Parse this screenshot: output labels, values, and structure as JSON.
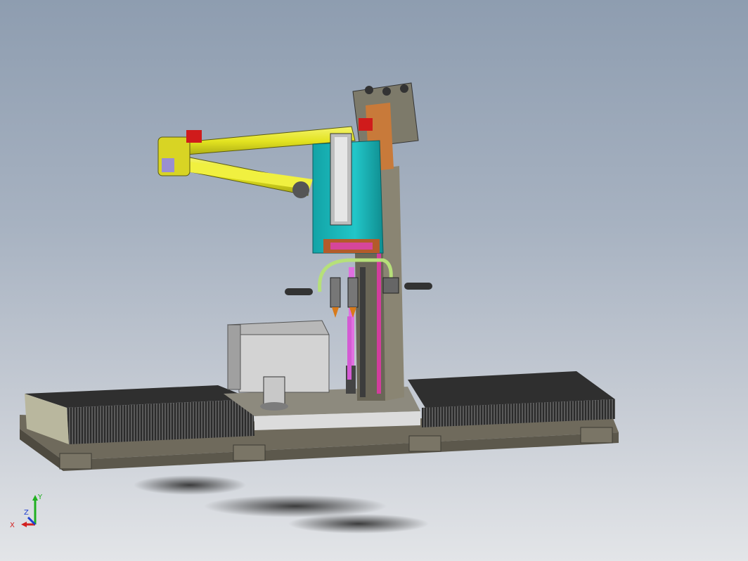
{
  "viewport": {
    "background_top": "#8e9db0",
    "background_bottom": "#e3e5e8"
  },
  "triad": {
    "x_label": "X",
    "y_label": "Y",
    "z_label": "Z",
    "x_color": "#d22020",
    "y_color": "#20b020",
    "z_color": "#2040d0"
  },
  "model": {
    "arm_color": "#e8e820",
    "carriage_color": "#1fb6b8",
    "base_color": "#6f6a5c",
    "grill_color": "#3a3a3a",
    "accent_color": "#d01b1b",
    "column_color": "#8a8573"
  }
}
